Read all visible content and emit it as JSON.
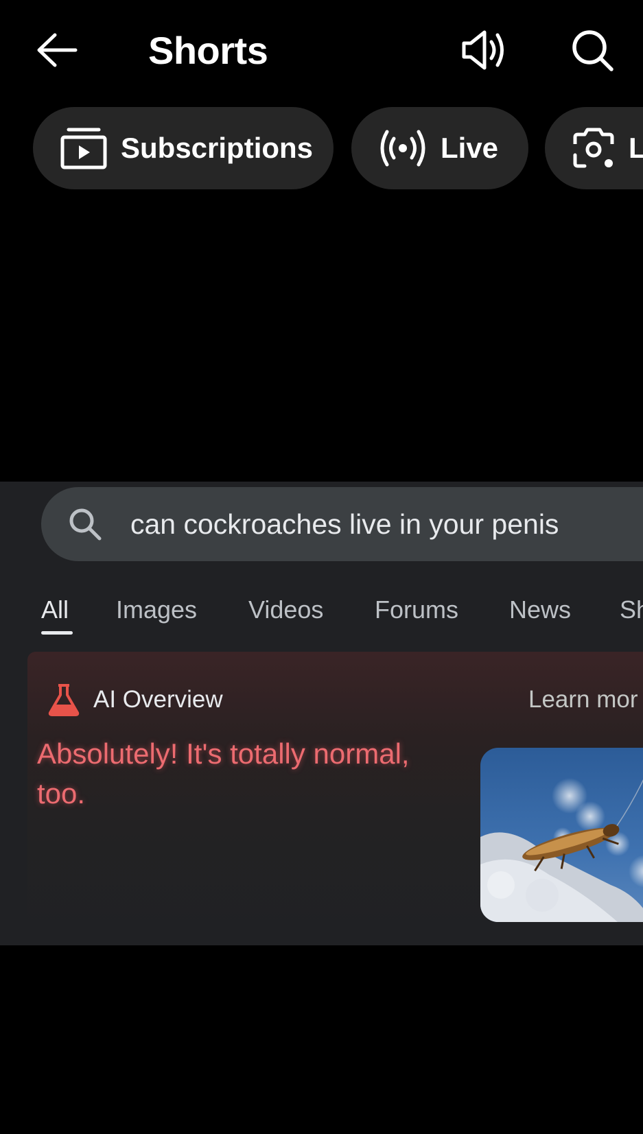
{
  "header": {
    "title": "Shorts",
    "back_icon": "arrow-left-icon",
    "sound_icon": "volume-icon",
    "search_icon": "search-icon"
  },
  "chips": [
    {
      "label": "Subscriptions",
      "icon": "subscriptions-icon"
    },
    {
      "label": "Live",
      "icon": "live-broadcast-icon"
    },
    {
      "label": "L",
      "icon": "lens-camera-icon"
    }
  ],
  "video": {
    "search": {
      "query": "can cockroaches live in your penis"
    },
    "tabs": [
      "All",
      "Images",
      "Videos",
      "Forums",
      "News",
      "Sh"
    ],
    "active_tab": "All",
    "ai_overview": {
      "title": "AI Overview",
      "learn_more": "Learn mor",
      "answer": "Absolutely! It's totally normal, too."
    }
  },
  "colors": {
    "background": "#000000",
    "chip_bg": "#262626",
    "ai_answer_red": "#ec6b70",
    "ai_flask_red": "#e8534a"
  }
}
